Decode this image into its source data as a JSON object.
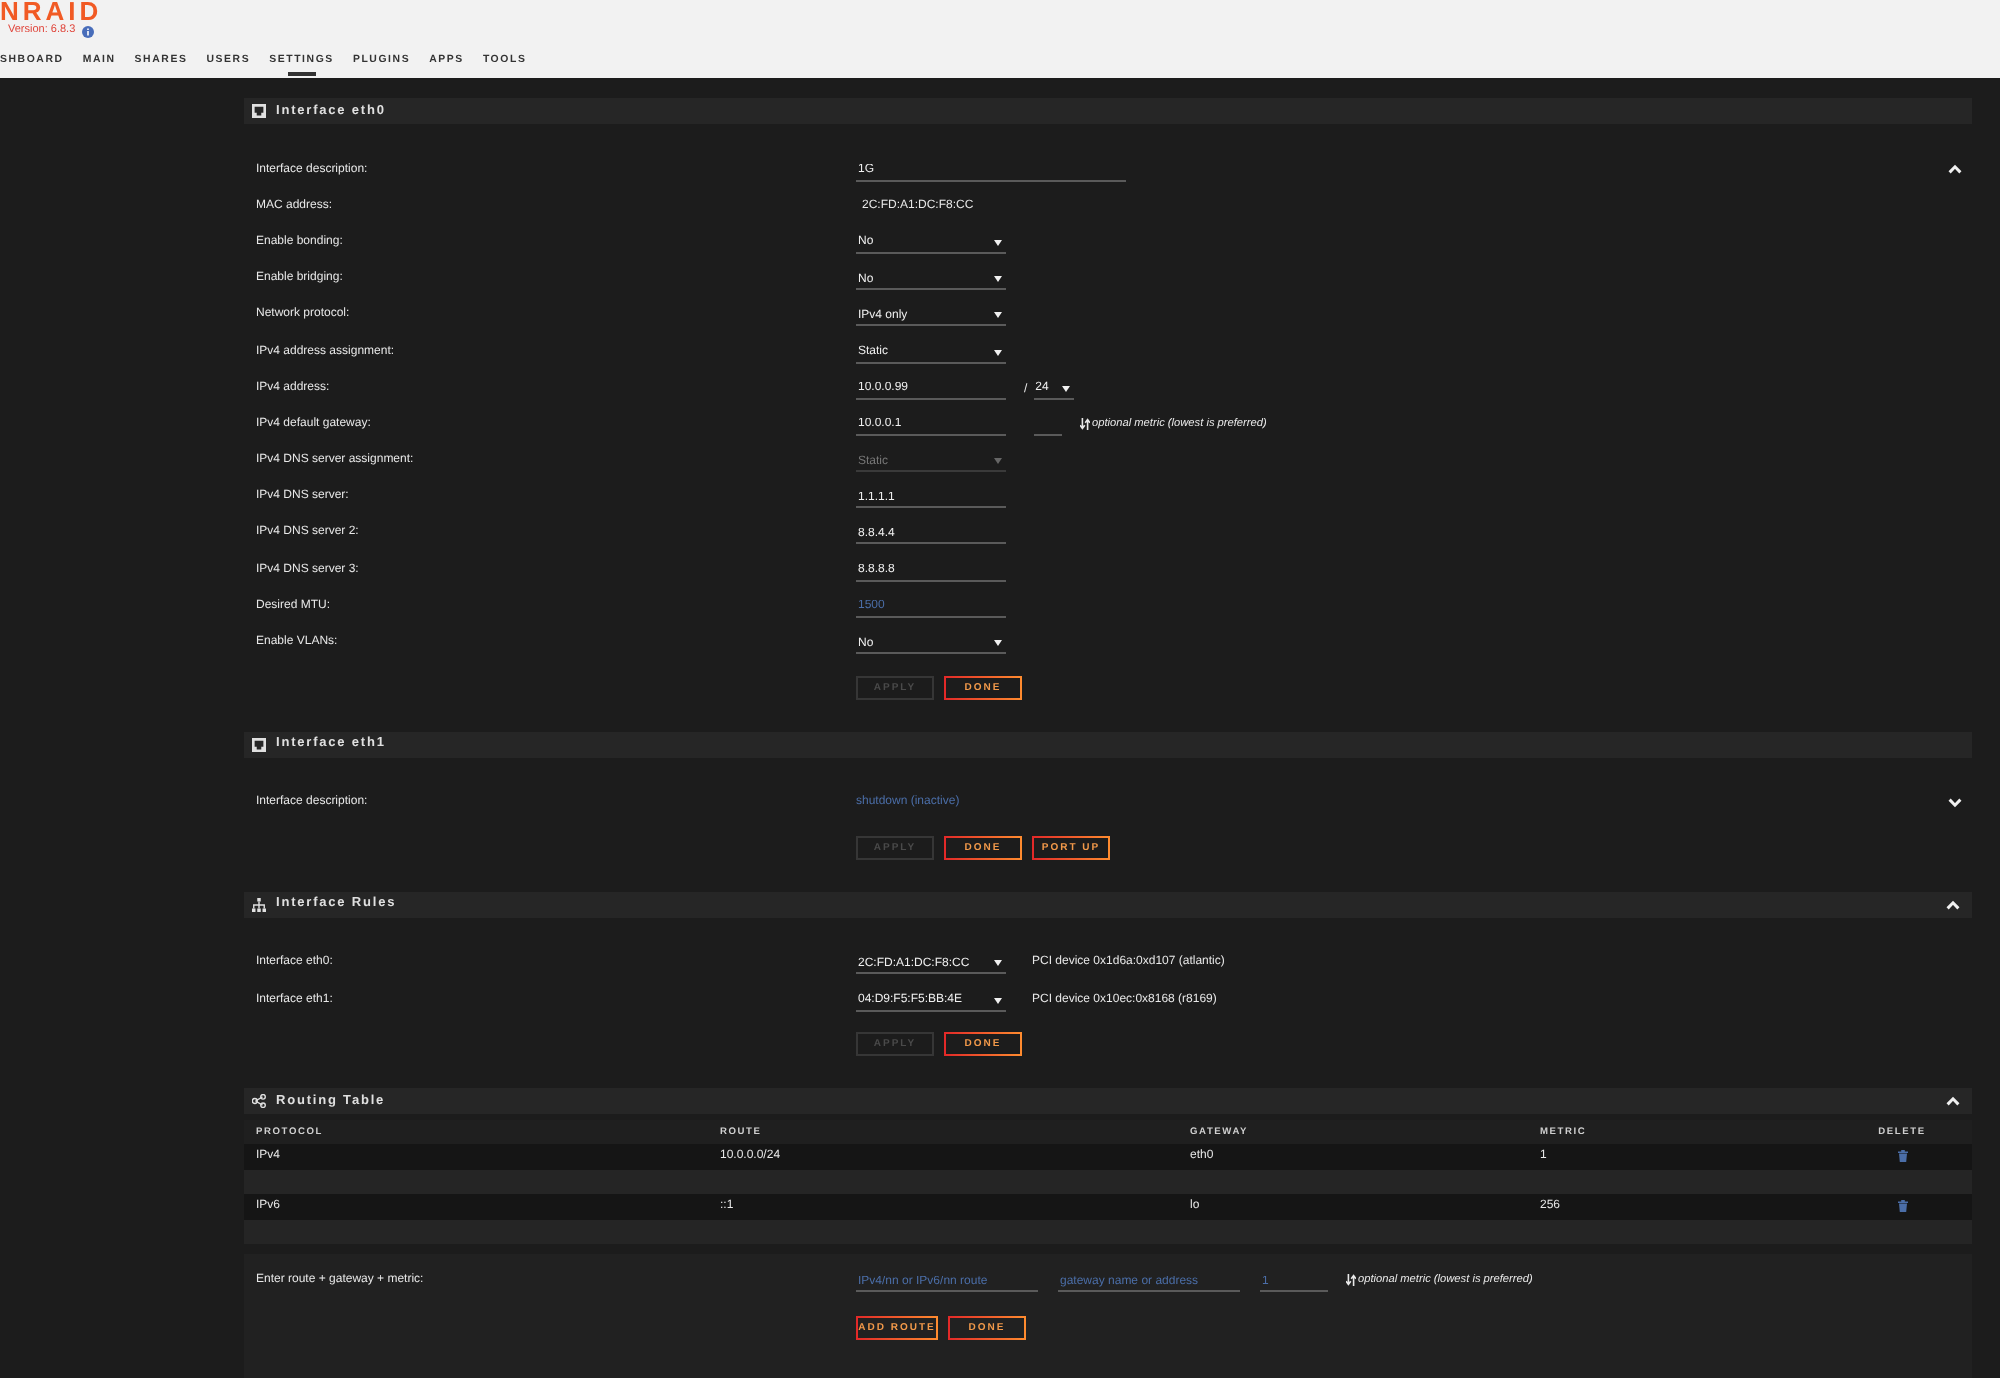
{
  "header": {
    "logo": "NRAID",
    "version": "Version: 6.8.3"
  },
  "nav": [
    {
      "label": "SHBOARD",
      "selected": false
    },
    {
      "label": "MAIN",
      "selected": false
    },
    {
      "label": "SHARES",
      "selected": false
    },
    {
      "label": "USERS",
      "selected": false
    },
    {
      "label": "SETTINGS",
      "selected": true
    },
    {
      "label": "PLUGINS",
      "selected": false
    },
    {
      "label": "APPS",
      "selected": false
    },
    {
      "label": "TOOLS",
      "selected": false
    }
  ],
  "sections": [
    {
      "kind": "interface",
      "title": "Interface eth0",
      "expanded": true,
      "rows": [
        {
          "label": "Interface description:",
          "fields": [
            {
              "kind": "text",
              "value": "1G"
            }
          ]
        },
        {
          "label": "MAC address:",
          "fields": [
            {
              "kind": "static",
              "text": "2C:FD:A1:DC:F8:CC"
            }
          ]
        },
        {
          "label": "Enable bonding:",
          "fields": [
            {
              "kind": "select",
              "value": "No",
              "disabled": false
            }
          ]
        },
        {
          "label": "Enable bridging:",
          "fields": [
            {
              "kind": "select",
              "value": "No",
              "disabled": false
            }
          ]
        },
        {
          "label": "Network protocol:",
          "fields": [
            {
              "kind": "select",
              "value": "IPv4 only",
              "disabled": false
            }
          ]
        },
        {
          "label": "IPv4 address assignment:",
          "fields": [
            {
              "kind": "select",
              "value": "Static",
              "disabled": false
            }
          ]
        },
        {
          "label": "IPv4 address:",
          "fields": [
            {
              "kind": "address",
              "value": "10.0.0.99"
            },
            {
              "kind": "mask",
              "prefix": "/",
              "value": "24",
              "disabled": false
            }
          ]
        },
        {
          "label": "IPv4 default gateway:",
          "fields": [
            {
              "kind": "address",
              "value": "10.0.0.1"
            },
            {
              "kind": "metric"
            },
            {
              "kind": "note",
              "text": "optional metric (lowest is preferred)"
            }
          ]
        },
        {
          "label": "IPv4 DNS server assignment:",
          "fields": [
            {
              "kind": "select",
              "value": "Static",
              "disabled": true
            }
          ]
        },
        {
          "label": "IPv4 DNS server:",
          "fields": [
            {
              "kind": "address",
              "value": "1.1.1.1"
            }
          ]
        },
        {
          "label": "IPv4 DNS server 2:",
          "fields": [
            {
              "kind": "address",
              "value": "8.8.4.4"
            }
          ]
        },
        {
          "label": "IPv4 DNS server 3:",
          "fields": [
            {
              "kind": "address",
              "value": "8.8.8.8"
            }
          ]
        },
        {
          "label": "Desired MTU:",
          "fields": [
            {
              "kind": "address",
              "placeholder": "1500"
            }
          ]
        },
        {
          "label": "Enable VLANs:",
          "fields": [
            {
              "kind": "select",
              "value": "No",
              "disabled": false
            }
          ]
        }
      ],
      "buttons": [
        {
          "label": "APPLY",
          "disabled": true
        },
        {
          "label": "DONE",
          "disabled": false
        }
      ]
    },
    {
      "kind": "interface",
      "title": "Interface eth1",
      "expanded": false,
      "rows": [
        {
          "label": "Interface description:",
          "fields": [
            {
              "kind": "status",
              "text": "shutdown (inactive)"
            }
          ]
        }
      ],
      "buttons": [
        {
          "label": "APPLY",
          "disabled": true
        },
        {
          "label": "DONE",
          "disabled": false
        },
        {
          "label": "PORT UP",
          "disabled": false
        }
      ]
    },
    {
      "kind": "rules",
      "title": "Interface Rules",
      "expanded": true,
      "rows": [
        {
          "label": "Interface eth0:",
          "fields": [
            {
              "kind": "select",
              "value": "2C:FD:A1:DC:F8:CC",
              "disabled": false
            },
            {
              "kind": "static",
              "text": "PCI device 0x1d6a:0xd107 (atlantic)"
            }
          ]
        },
        {
          "label": "Interface eth1:",
          "fields": [
            {
              "kind": "select",
              "value": "04:D9:F5:F5:BB:4E",
              "disabled": false
            },
            {
              "kind": "static",
              "text": "PCI device 0x10ec:0x8168 (r8169)"
            }
          ]
        }
      ],
      "buttons": [
        {
          "label": "APPLY",
          "disabled": true
        },
        {
          "label": "DONE",
          "disabled": false
        }
      ]
    },
    {
      "kind": "routing",
      "title": "Routing Table",
      "expanded": true,
      "table": {
        "columns": [
          "PROTOCOL",
          "ROUTE",
          "GATEWAY",
          "METRIC",
          "DELETE"
        ],
        "rows": [
          [
            "IPv4",
            "10.0.0.0/24",
            "eth0",
            "1"
          ],
          [
            "IPv6",
            "::1",
            "lo",
            "256"
          ]
        ]
      },
      "form": {
        "label": "Enter route + gateway + metric:",
        "fields": [
          {
            "kind": "route",
            "placeholder": "IPv4/nn or IPv6/nn route"
          },
          {
            "kind": "route",
            "placeholder": "gateway name or address"
          },
          {
            "kind": "metric",
            "placeholder": "1"
          },
          {
            "kind": "note",
            "text": "optional metric (lowest is preferred)"
          }
        ],
        "buttons": [
          {
            "label": "ADD ROUTE",
            "disabled": false
          },
          {
            "label": "DONE",
            "disabled": false
          }
        ]
      }
    }
  ]
}
